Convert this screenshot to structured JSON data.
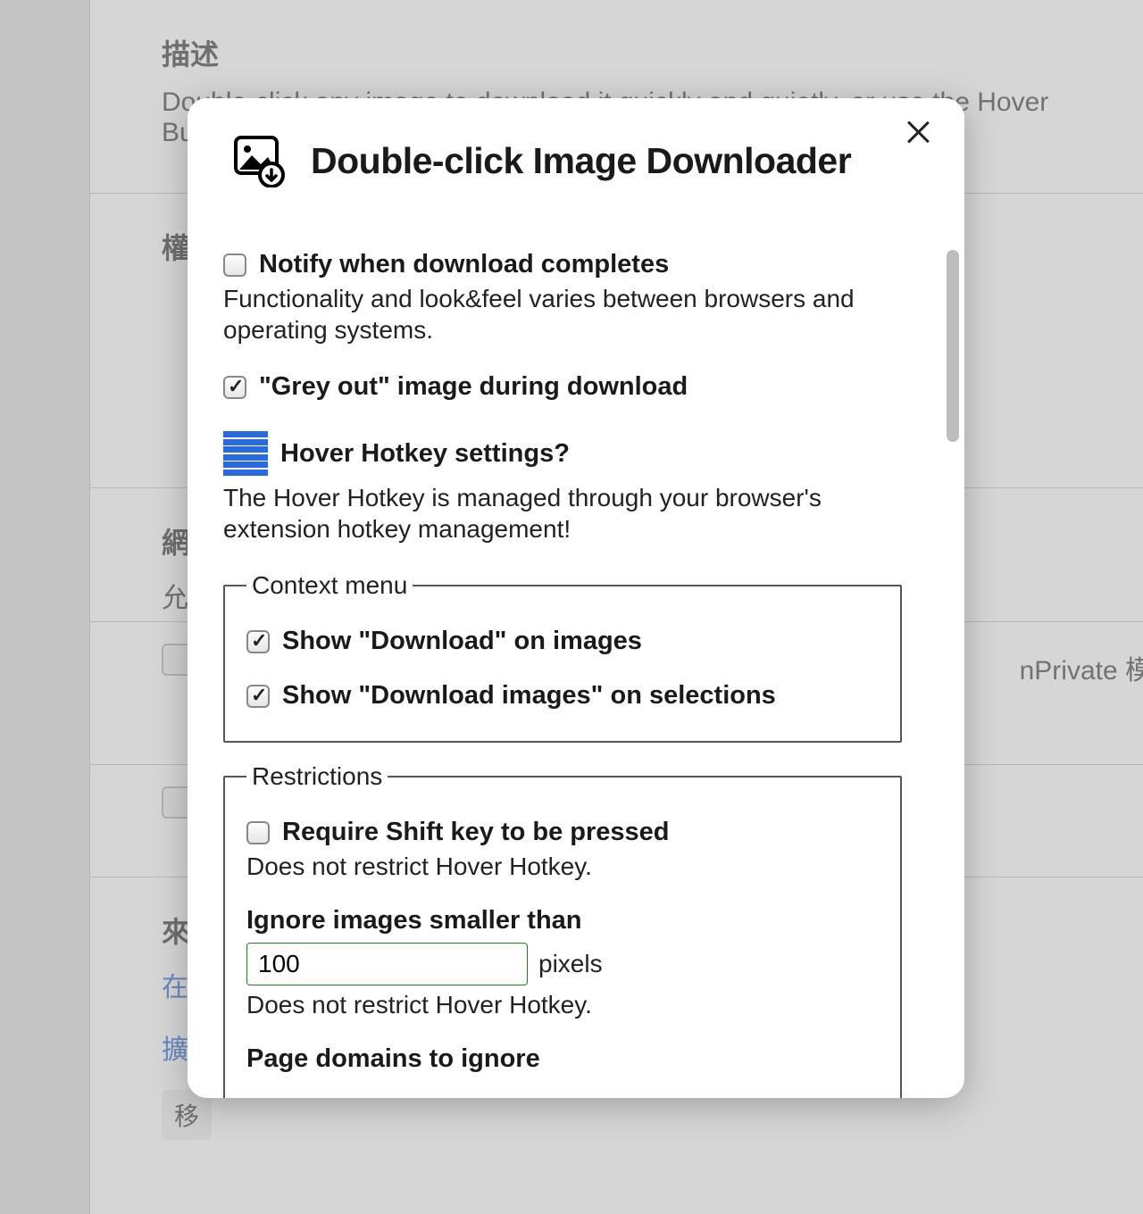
{
  "background": {
    "desc_heading": "描述",
    "desc_text": "Double-click any image to download it quickly and quietly, or use the Hover Bu",
    "perm_heading": "權",
    "site_heading": "網",
    "site_sub": "允",
    "inprivate": "nPrivate 模式",
    "source_heading": "來",
    "link1": "在",
    "link2": "擴",
    "btn": "移"
  },
  "modal": {
    "title": "Double-click Image Downloader",
    "options": {
      "notify_label": "Notify when download completes",
      "notify_help": "Functionality and look&feel varies between browsers and operating systems.",
      "greyout_label": "\"Grey out\" image during download",
      "hh_label": "Hover Hotkey settings?",
      "hh_help": "The Hover Hotkey is managed through your browser's extension hotkey management!"
    },
    "fieldsets": {
      "ctx_legend": "Context menu",
      "ctx_item1": "Show \"Download\" on images",
      "ctx_item2": "Show \"Download images\" on selections",
      "res_legend": "Restrictions",
      "res_shift_label": "Require Shift key to be pressed",
      "res_shift_help": "Does not restrict Hover Hotkey.",
      "res_ignore_label": "Ignore images smaller than",
      "res_ignore_value": "100",
      "res_ignore_unit": "pixels",
      "res_ignore_help": "Does not restrict Hover Hotkey.",
      "res_domains_label": "Page domains to ignore"
    }
  }
}
